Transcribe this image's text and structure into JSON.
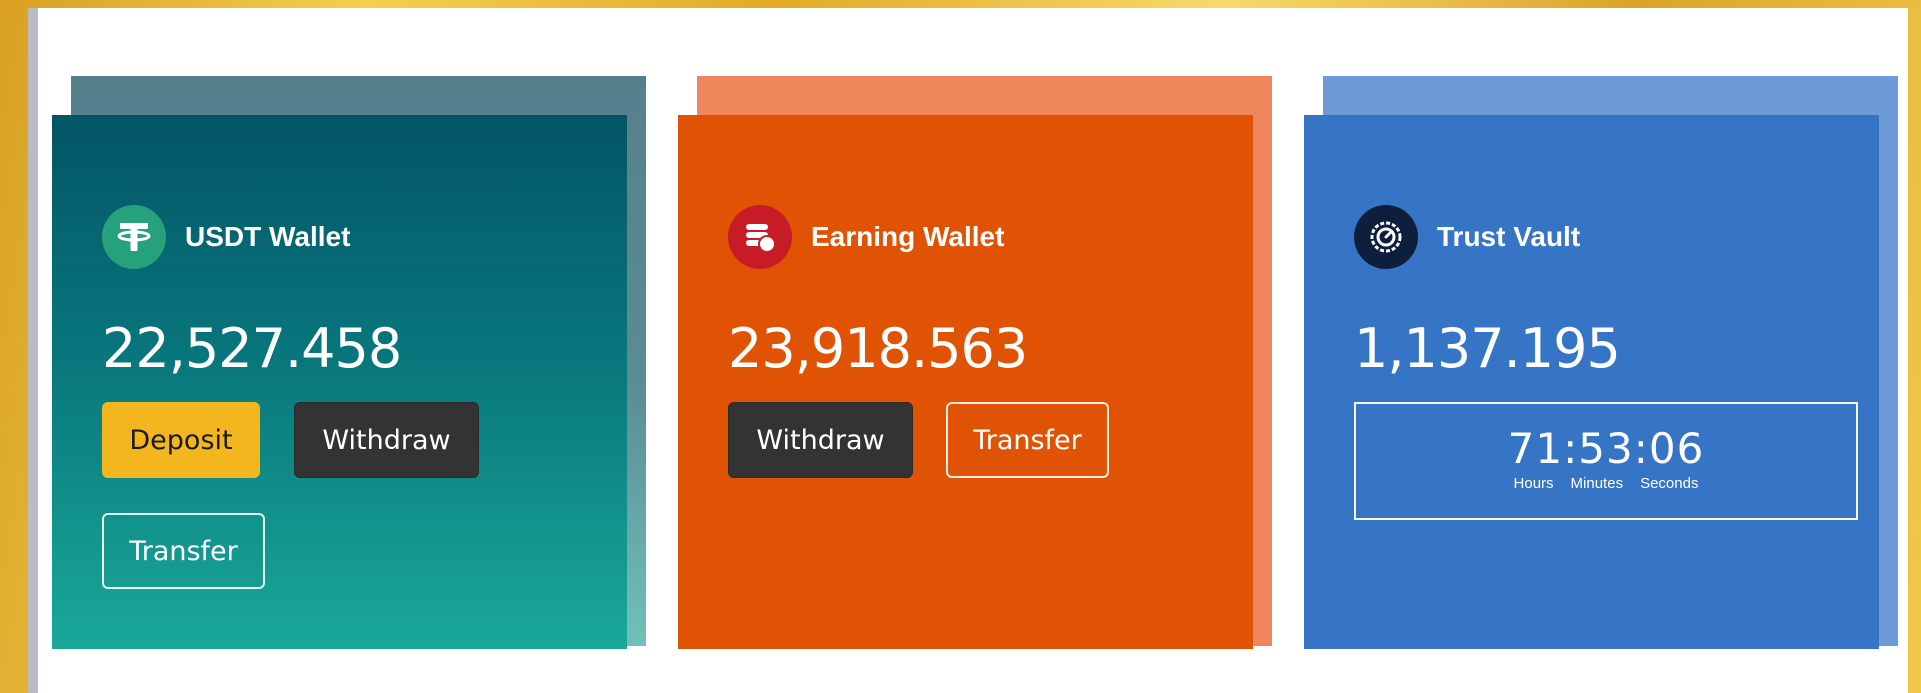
{
  "wallets": [
    {
      "title": "USDT Wallet",
      "icon": "tether-icon",
      "amount": "22,527.458",
      "buttons": [
        "Deposit",
        "Withdraw",
        "Transfer"
      ]
    },
    {
      "title": "Earning Wallet",
      "icon": "coins-icon",
      "amount": "23,918.563",
      "buttons": [
        "Withdraw",
        "Transfer"
      ]
    },
    {
      "title": "Trust Vault",
      "icon": "vault-icon",
      "amount": "1,137.195",
      "countdown": {
        "value": "71:53:06",
        "labels": [
          "Hours",
          "Minutes",
          "Seconds"
        ]
      }
    }
  ],
  "colors": {
    "usdt_gradient": [
      "#035565",
      "#1aa898"
    ],
    "earning": "#e15304",
    "trust_vault": "#3674c6",
    "deposit_button": "#f3b61f",
    "dark_button": "#333333"
  }
}
